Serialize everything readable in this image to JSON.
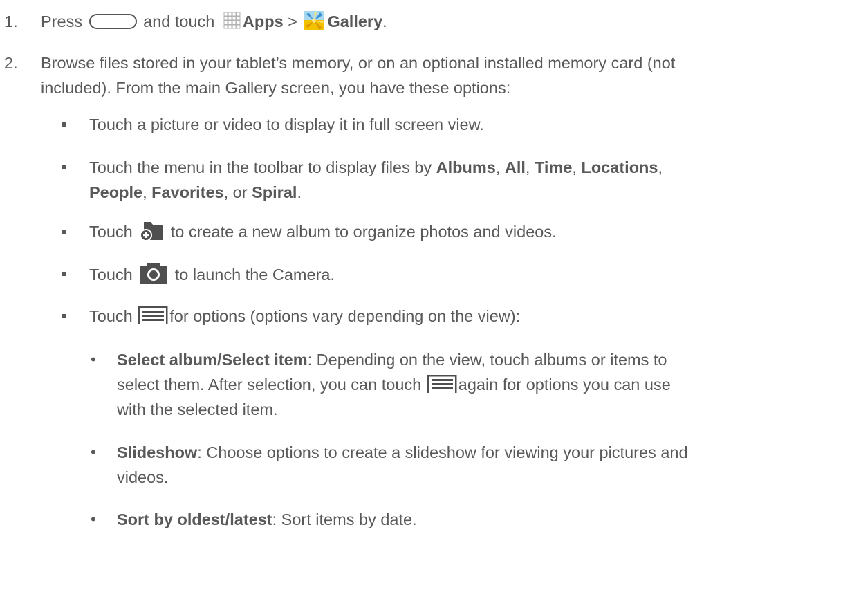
{
  "step1": {
    "num": "1.",
    "press": "Press",
    "and_touch": "and touch",
    "apps": "Apps",
    "arrow": ">",
    "gallery": "Gallery",
    "period": "."
  },
  "step2": {
    "num": "2.",
    "line1": "Browse files stored in your tablet’s memory, or on an optional installed memory card (not",
    "line2": "included). From the main Gallery screen, you have these options:"
  },
  "bullets": {
    "b1": "Touch a picture or video to display it in full screen view.",
    "b2_pre": "Touch the menu in the toolbar to display files by",
    "albums": "Albums",
    "all": "All",
    "time": "Time",
    "locations": "Locations",
    "people": "People",
    "favorites": "Favorites",
    "spiral": "Spiral",
    "comma": ",",
    "or": ", or",
    "b3_pre": "Touch",
    "b3_post": "to create a new album to organize photos and videos.",
    "b4_pre": "Touch",
    "b4_post": "to launch the Camera.",
    "b5_pre": "Touch",
    "b5_post": "for options (options vary depending on the view):"
  },
  "sub": {
    "s1_title": "Select album/Select item",
    "s1_l1": ": Depending on the view, touch albums or items to",
    "s1_l2_pre": "select them. After selection, you can touch",
    "s1_l2_post": "again for options you can use",
    "s1_l3": "with the selected item.",
    "s2_title": "Slideshow",
    "s2_l1": ": Choose options to create a slideshow for viewing your pictures and",
    "s2_l2": "videos.",
    "s3_title": "Sort by oldest/latest",
    "s3_l1": ": Sort items by date.",
    "bullet_char": "•"
  },
  "icons": [
    "home-key-icon",
    "apps-grid-icon",
    "gallery-icon",
    "new-album-icon",
    "camera-icon",
    "menu-icon"
  ]
}
